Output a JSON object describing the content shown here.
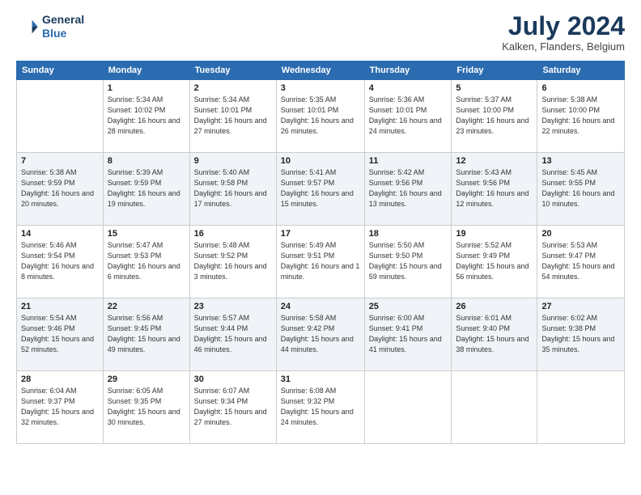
{
  "logo": {
    "line1": "General",
    "line2": "Blue"
  },
  "title": "July 2024",
  "location": "Kalken, Flanders, Belgium",
  "days_of_week": [
    "Sunday",
    "Monday",
    "Tuesday",
    "Wednesday",
    "Thursday",
    "Friday",
    "Saturday"
  ],
  "weeks": [
    [
      {
        "num": "",
        "sunrise": "",
        "sunset": "",
        "daylight": ""
      },
      {
        "num": "1",
        "sunrise": "Sunrise: 5:34 AM",
        "sunset": "Sunset: 10:02 PM",
        "daylight": "Daylight: 16 hours and 28 minutes."
      },
      {
        "num": "2",
        "sunrise": "Sunrise: 5:34 AM",
        "sunset": "Sunset: 10:01 PM",
        "daylight": "Daylight: 16 hours and 27 minutes."
      },
      {
        "num": "3",
        "sunrise": "Sunrise: 5:35 AM",
        "sunset": "Sunset: 10:01 PM",
        "daylight": "Daylight: 16 hours and 26 minutes."
      },
      {
        "num": "4",
        "sunrise": "Sunrise: 5:36 AM",
        "sunset": "Sunset: 10:01 PM",
        "daylight": "Daylight: 16 hours and 24 minutes."
      },
      {
        "num": "5",
        "sunrise": "Sunrise: 5:37 AM",
        "sunset": "Sunset: 10:00 PM",
        "daylight": "Daylight: 16 hours and 23 minutes."
      },
      {
        "num": "6",
        "sunrise": "Sunrise: 5:38 AM",
        "sunset": "Sunset: 10:00 PM",
        "daylight": "Daylight: 16 hours and 22 minutes."
      }
    ],
    [
      {
        "num": "7",
        "sunrise": "Sunrise: 5:38 AM",
        "sunset": "Sunset: 9:59 PM",
        "daylight": "Daylight: 16 hours and 20 minutes."
      },
      {
        "num": "8",
        "sunrise": "Sunrise: 5:39 AM",
        "sunset": "Sunset: 9:59 PM",
        "daylight": "Daylight: 16 hours and 19 minutes."
      },
      {
        "num": "9",
        "sunrise": "Sunrise: 5:40 AM",
        "sunset": "Sunset: 9:58 PM",
        "daylight": "Daylight: 16 hours and 17 minutes."
      },
      {
        "num": "10",
        "sunrise": "Sunrise: 5:41 AM",
        "sunset": "Sunset: 9:57 PM",
        "daylight": "Daylight: 16 hours and 15 minutes."
      },
      {
        "num": "11",
        "sunrise": "Sunrise: 5:42 AM",
        "sunset": "Sunset: 9:56 PM",
        "daylight": "Daylight: 16 hours and 13 minutes."
      },
      {
        "num": "12",
        "sunrise": "Sunrise: 5:43 AM",
        "sunset": "Sunset: 9:56 PM",
        "daylight": "Daylight: 16 hours and 12 minutes."
      },
      {
        "num": "13",
        "sunrise": "Sunrise: 5:45 AM",
        "sunset": "Sunset: 9:55 PM",
        "daylight": "Daylight: 16 hours and 10 minutes."
      }
    ],
    [
      {
        "num": "14",
        "sunrise": "Sunrise: 5:46 AM",
        "sunset": "Sunset: 9:54 PM",
        "daylight": "Daylight: 16 hours and 8 minutes."
      },
      {
        "num": "15",
        "sunrise": "Sunrise: 5:47 AM",
        "sunset": "Sunset: 9:53 PM",
        "daylight": "Daylight: 16 hours and 6 minutes."
      },
      {
        "num": "16",
        "sunrise": "Sunrise: 5:48 AM",
        "sunset": "Sunset: 9:52 PM",
        "daylight": "Daylight: 16 hours and 3 minutes."
      },
      {
        "num": "17",
        "sunrise": "Sunrise: 5:49 AM",
        "sunset": "Sunset: 9:51 PM",
        "daylight": "Daylight: 16 hours and 1 minute."
      },
      {
        "num": "18",
        "sunrise": "Sunrise: 5:50 AM",
        "sunset": "Sunset: 9:50 PM",
        "daylight": "Daylight: 15 hours and 59 minutes."
      },
      {
        "num": "19",
        "sunrise": "Sunrise: 5:52 AM",
        "sunset": "Sunset: 9:49 PM",
        "daylight": "Daylight: 15 hours and 56 minutes."
      },
      {
        "num": "20",
        "sunrise": "Sunrise: 5:53 AM",
        "sunset": "Sunset: 9:47 PM",
        "daylight": "Daylight: 15 hours and 54 minutes."
      }
    ],
    [
      {
        "num": "21",
        "sunrise": "Sunrise: 5:54 AM",
        "sunset": "Sunset: 9:46 PM",
        "daylight": "Daylight: 15 hours and 52 minutes."
      },
      {
        "num": "22",
        "sunrise": "Sunrise: 5:56 AM",
        "sunset": "Sunset: 9:45 PM",
        "daylight": "Daylight: 15 hours and 49 minutes."
      },
      {
        "num": "23",
        "sunrise": "Sunrise: 5:57 AM",
        "sunset": "Sunset: 9:44 PM",
        "daylight": "Daylight: 15 hours and 46 minutes."
      },
      {
        "num": "24",
        "sunrise": "Sunrise: 5:58 AM",
        "sunset": "Sunset: 9:42 PM",
        "daylight": "Daylight: 15 hours and 44 minutes."
      },
      {
        "num": "25",
        "sunrise": "Sunrise: 6:00 AM",
        "sunset": "Sunset: 9:41 PM",
        "daylight": "Daylight: 15 hours and 41 minutes."
      },
      {
        "num": "26",
        "sunrise": "Sunrise: 6:01 AM",
        "sunset": "Sunset: 9:40 PM",
        "daylight": "Daylight: 15 hours and 38 minutes."
      },
      {
        "num": "27",
        "sunrise": "Sunrise: 6:02 AM",
        "sunset": "Sunset: 9:38 PM",
        "daylight": "Daylight: 15 hours and 35 minutes."
      }
    ],
    [
      {
        "num": "28",
        "sunrise": "Sunrise: 6:04 AM",
        "sunset": "Sunset: 9:37 PM",
        "daylight": "Daylight: 15 hours and 32 minutes."
      },
      {
        "num": "29",
        "sunrise": "Sunrise: 6:05 AM",
        "sunset": "Sunset: 9:35 PM",
        "daylight": "Daylight: 15 hours and 30 minutes."
      },
      {
        "num": "30",
        "sunrise": "Sunrise: 6:07 AM",
        "sunset": "Sunset: 9:34 PM",
        "daylight": "Daylight: 15 hours and 27 minutes."
      },
      {
        "num": "31",
        "sunrise": "Sunrise: 6:08 AM",
        "sunset": "Sunset: 9:32 PM",
        "daylight": "Daylight: 15 hours and 24 minutes."
      },
      {
        "num": "",
        "sunrise": "",
        "sunset": "",
        "daylight": ""
      },
      {
        "num": "",
        "sunrise": "",
        "sunset": "",
        "daylight": ""
      },
      {
        "num": "",
        "sunrise": "",
        "sunset": "",
        "daylight": ""
      }
    ]
  ]
}
